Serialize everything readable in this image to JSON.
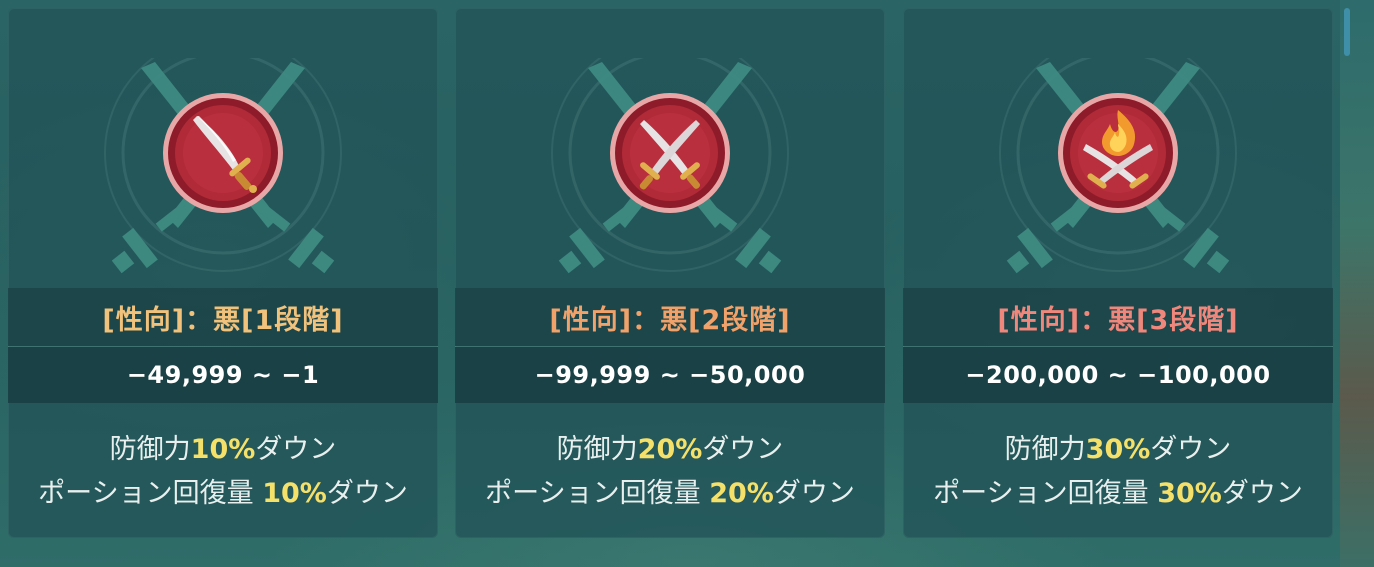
{
  "colors": {
    "tier1_title": "#f1c27b",
    "tier2_title": "#f0a26a",
    "tier3_title": "#f0877c",
    "highlight": "#f5e06a",
    "emblem_red": "#9c1f2e",
    "emblem_ring": "#e7a0a2"
  },
  "cards": [
    {
      "icon": "single-dagger-emblem-icon",
      "title": "[性向]：悪[1段階]",
      "range": "−49,999 ~ −1",
      "effect1_prefix": "防御力",
      "effect1_value": "10%",
      "effect1_suffix": "ダウン",
      "effect2_prefix": "ポーション回復量 ",
      "effect2_value": "10%",
      "effect2_suffix": "ダウン"
    },
    {
      "icon": "crossed-daggers-emblem-icon",
      "title": "[性向]：悪[2段階]",
      "range": "−99,999 ~ −50,000",
      "effect1_prefix": "防御力",
      "effect1_value": "20%",
      "effect1_suffix": "ダウン",
      "effect2_prefix": "ポーション回復量 ",
      "effect2_value": "20%",
      "effect2_suffix": "ダウン"
    },
    {
      "icon": "flaming-daggers-emblem-icon",
      "title": "[性向]：悪[3段階]",
      "range": "−200,000 ~ −100,000",
      "effect1_prefix": "防御力",
      "effect1_value": "30%",
      "effect1_suffix": "ダウン",
      "effect2_prefix": "ポーション回復量 ",
      "effect2_value": "30%",
      "effect2_suffix": "ダウン"
    }
  ]
}
